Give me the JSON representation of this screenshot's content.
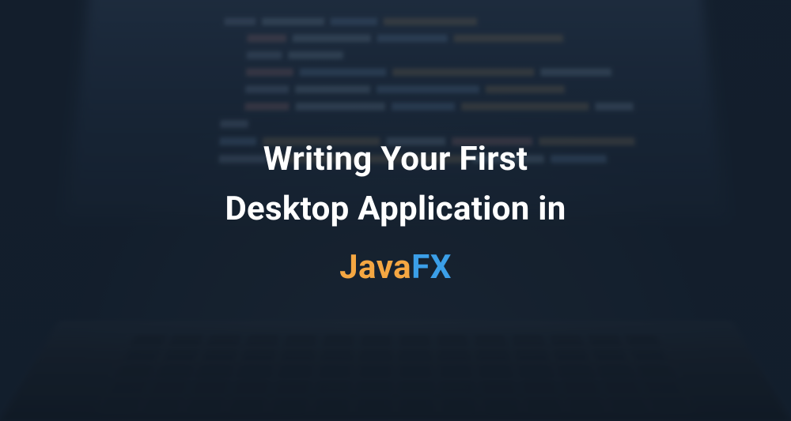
{
  "hero": {
    "line1": "Writing Your First",
    "line2": "Desktop Application in",
    "brand_part1": "Java",
    "brand_part2": "FX"
  },
  "colors": {
    "brand_java": "#f5a742",
    "brand_fx": "#3b9fe8",
    "text": "#ffffff"
  }
}
